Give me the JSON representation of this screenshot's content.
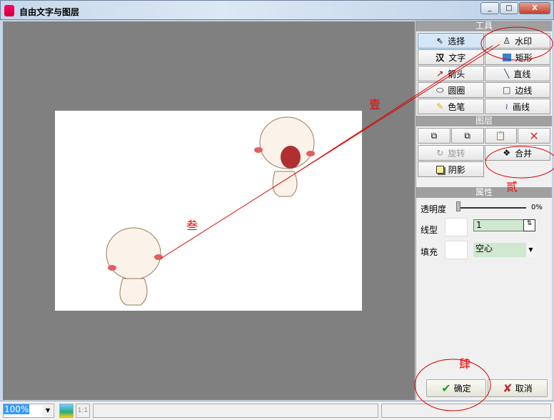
{
  "window": {
    "title": "自由文字与图层",
    "min": "_",
    "max": "□",
    "close": "X"
  },
  "tools": {
    "header": "工具",
    "items": [
      "选择",
      "水印",
      "文字",
      "矩形",
      "箭头",
      "直线",
      "圆圈",
      "边线",
      "色笔",
      "画线"
    ]
  },
  "layers": {
    "header": "图层",
    "rotate": "旋转",
    "merge": "合并",
    "shadow": "阴影"
  },
  "props": {
    "header": "属性",
    "opacity_label": "透明度",
    "opacity_value": "0%",
    "opacity": 0,
    "line_label": "线型",
    "line_value": "1",
    "fill_label": "填充",
    "fill_value": "空心"
  },
  "buttons": {
    "ok": "确定",
    "cancel": "取消"
  },
  "status": {
    "zoom": "100%",
    "one_to_one": "1:1"
  },
  "annotations": {
    "a1": "壹",
    "a2": "贰",
    "a3": "叁",
    "a4": "肆"
  },
  "colors": {
    "annotation": "#e00000",
    "canvas": "#808080"
  }
}
